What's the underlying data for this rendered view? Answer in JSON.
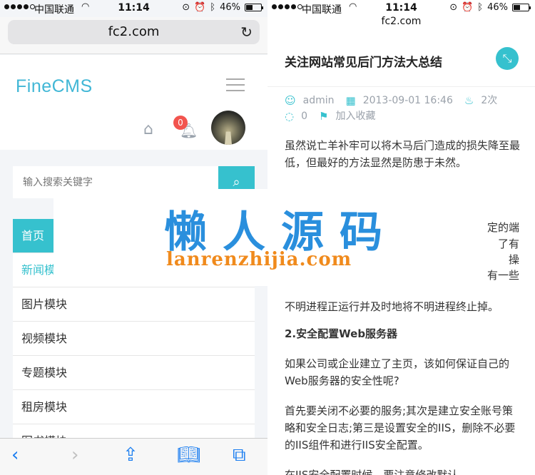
{
  "status": {
    "carrier": "中国联通",
    "time": "11:14",
    "battery": "46%",
    "battery_level": 0.46
  },
  "left": {
    "url": "fc2.com",
    "logo": "FineCMS",
    "notification_count": "0",
    "search": {
      "placeholder": "输入搜索关键字"
    },
    "menu": [
      {
        "label": "首页"
      },
      {
        "label": "新闻模块"
      },
      {
        "label": "图片模块"
      },
      {
        "label": "视频模块"
      },
      {
        "label": "专题模块"
      },
      {
        "label": "租房模块"
      },
      {
        "label": "图书模块"
      }
    ]
  },
  "watermark": {
    "title": "懒人源码",
    "domain": "lanrenzhijia.com"
  },
  "right": {
    "url": "fc2.com",
    "article": {
      "title": "关注网站常见后门方法大总结",
      "author": "admin",
      "date": "2013-09-01 16:46",
      "views": "2次",
      "comments": "0",
      "favorite": "加入收藏",
      "para1": "虽然说亡羊补牢可以将木马后门造成的损失降至最低，但最好的方法显然是防患于未然。",
      "frag1": "定的端",
      "frag2": "了有",
      "frag3": "操",
      "frag4": "有一些",
      "para2": "不明进程正运行并及时地将不明进程终止掉。",
      "heading2": "2.安全配置Web服务器",
      "para3": "如果公司或企业建立了主页，该如何保证自己的Web服务器的安全性呢?",
      "para4": "首先要关闭不必要的服务;其次是建立安全账号策略和安全日志;第三是设置安全的IIS，删除不必要的IIS组件和进行IIS安全配置。",
      "para5": "在IIS安全配置时候，要注意修改默认"
    }
  }
}
